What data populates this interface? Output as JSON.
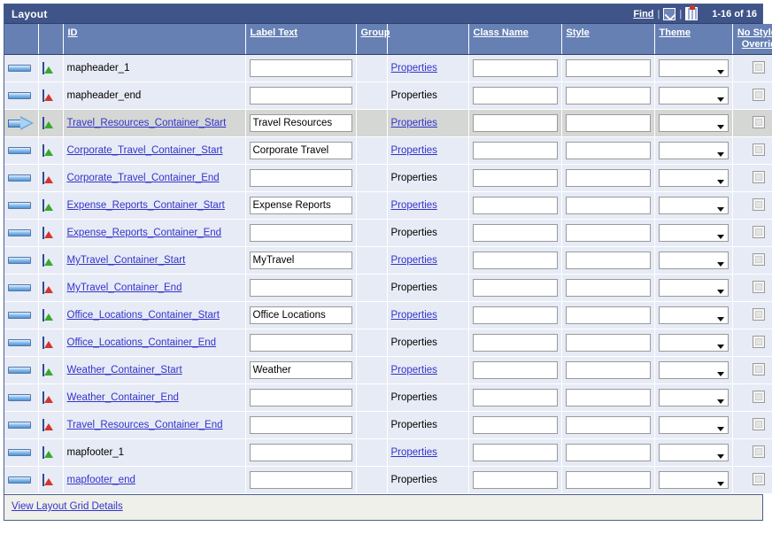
{
  "panel": {
    "title": "Layout",
    "nav": {
      "find_label": "Find",
      "separator": "|",
      "expand_icon": "expand-all-icon",
      "download_icon": "download-to-spreadsheet-icon",
      "row_count": "1-16 of 16"
    },
    "footer_link": "View Layout Grid Details"
  },
  "columns": [
    {
      "key": "select",
      "label": "",
      "link": false
    },
    {
      "key": "icon",
      "label": "",
      "link": false
    },
    {
      "key": "id",
      "label": "ID",
      "link": true
    },
    {
      "key": "label_text",
      "label": "Label Text",
      "link": true
    },
    {
      "key": "group",
      "label": "Group",
      "link": true
    },
    {
      "key": "properties",
      "label": "",
      "link": false
    },
    {
      "key": "class_name",
      "label": "Class Name",
      "link": true
    },
    {
      "key": "style",
      "label": "Style",
      "link": true
    },
    {
      "key": "theme",
      "label": "Theme",
      "link": true
    },
    {
      "key": "no_styles",
      "label": "No Styles Override",
      "link": true
    }
  ],
  "colors": {
    "title_bar": "#3f5488",
    "column_header": "#6680b4",
    "row_background": "#e7ebf5",
    "selected_row": "#d4d7d4",
    "link": "#3333cc",
    "footer_background": "#eff0e9",
    "start_marker": "#3aa82a",
    "end_marker": "#d8342b"
  },
  "rows": [
    {
      "selected": false,
      "marker": "dash",
      "icon": "header-page-icon",
      "icon_kind": "header",
      "badge": "green",
      "id": "mapheader_1",
      "id_is_link": false,
      "label_text": "",
      "properties_label": "Properties",
      "properties_is_link": true,
      "class_name": "",
      "style": "",
      "theme": "",
      "no_styles_override": false
    },
    {
      "selected": false,
      "marker": "dash",
      "icon": "header-page-icon",
      "icon_kind": "header",
      "badge": "red",
      "id": "mapheader_end",
      "id_is_link": false,
      "label_text": "",
      "properties_label": "Properties",
      "properties_is_link": false,
      "class_name": "",
      "style": "",
      "theme": "",
      "no_styles_override": false
    },
    {
      "selected": true,
      "marker": "arrow",
      "icon": "container-icon",
      "icon_kind": "container",
      "badge": "green",
      "id": "Travel_Resources_Container_Start",
      "id_is_link": true,
      "label_text": "Travel Resources",
      "properties_label": "Properties",
      "properties_is_link": true,
      "class_name": "",
      "style": "",
      "theme": "",
      "no_styles_override": false
    },
    {
      "selected": false,
      "marker": "dash",
      "icon": "container-icon",
      "icon_kind": "container",
      "badge": "green",
      "id": "Corporate_Travel_Container_Start",
      "id_is_link": true,
      "label_text": "Corporate Travel",
      "properties_label": "Properties",
      "properties_is_link": true,
      "class_name": "",
      "style": "",
      "theme": "",
      "no_styles_override": false
    },
    {
      "selected": false,
      "marker": "dash",
      "icon": "container-icon",
      "icon_kind": "container",
      "badge": "red",
      "id": "Corporate_Travel_Container_End",
      "id_is_link": true,
      "label_text": "",
      "properties_label": "Properties",
      "properties_is_link": false,
      "class_name": "",
      "style": "",
      "theme": "",
      "no_styles_override": false
    },
    {
      "selected": false,
      "marker": "dash",
      "icon": "container-icon",
      "icon_kind": "container",
      "badge": "green",
      "id": "Expense_Reports_Container_Start",
      "id_is_link": true,
      "label_text": "Expense Reports",
      "properties_label": "Properties",
      "properties_is_link": true,
      "class_name": "",
      "style": "",
      "theme": "",
      "no_styles_override": false
    },
    {
      "selected": false,
      "marker": "dash",
      "icon": "container-icon",
      "icon_kind": "container",
      "badge": "red",
      "id": "Expense_Reports_Container_End",
      "id_is_link": true,
      "label_text": "",
      "properties_label": "Properties",
      "properties_is_link": false,
      "class_name": "",
      "style": "",
      "theme": "",
      "no_styles_override": false
    },
    {
      "selected": false,
      "marker": "dash",
      "icon": "container-icon",
      "icon_kind": "container",
      "badge": "green",
      "id": "MyTravel_Container_Start",
      "id_is_link": true,
      "label_text": "MyTravel",
      "properties_label": "Properties",
      "properties_is_link": true,
      "class_name": "",
      "style": "",
      "theme": "",
      "no_styles_override": false
    },
    {
      "selected": false,
      "marker": "dash",
      "icon": "container-icon",
      "icon_kind": "container",
      "badge": "red",
      "id": "MyTravel_Container_End",
      "id_is_link": true,
      "label_text": "",
      "properties_label": "Properties",
      "properties_is_link": false,
      "class_name": "",
      "style": "",
      "theme": "",
      "no_styles_override": false
    },
    {
      "selected": false,
      "marker": "dash",
      "icon": "container-icon",
      "icon_kind": "container",
      "badge": "green",
      "id": "Office_Locations_Container_Start",
      "id_is_link": true,
      "label_text": "Office Locations",
      "properties_label": "Properties",
      "properties_is_link": true,
      "class_name": "",
      "style": "",
      "theme": "",
      "no_styles_override": false
    },
    {
      "selected": false,
      "marker": "dash",
      "icon": "container-icon",
      "icon_kind": "container",
      "badge": "red",
      "id": "Office_Locations_Container_End",
      "id_is_link": true,
      "label_text": "",
      "properties_label": "Properties",
      "properties_is_link": false,
      "class_name": "",
      "style": "",
      "theme": "",
      "no_styles_override": false
    },
    {
      "selected": false,
      "marker": "dash",
      "icon": "container-icon",
      "icon_kind": "container",
      "badge": "green",
      "id": "Weather_Container_Start",
      "id_is_link": true,
      "label_text": "Weather",
      "properties_label": "Properties",
      "properties_is_link": true,
      "class_name": "",
      "style": "",
      "theme": "",
      "no_styles_override": false
    },
    {
      "selected": false,
      "marker": "dash",
      "icon": "container-icon",
      "icon_kind": "container",
      "badge": "red",
      "id": "Weather_Container_End",
      "id_is_link": true,
      "label_text": "",
      "properties_label": "Properties",
      "properties_is_link": false,
      "class_name": "",
      "style": "",
      "theme": "",
      "no_styles_override": false
    },
    {
      "selected": false,
      "marker": "dash",
      "icon": "container-icon",
      "icon_kind": "container",
      "badge": "red",
      "id": "Travel_Resources_Container_End",
      "id_is_link": true,
      "label_text": "",
      "properties_label": "Properties",
      "properties_is_link": false,
      "class_name": "",
      "style": "",
      "theme": "",
      "no_styles_override": false
    },
    {
      "selected": false,
      "marker": "dash",
      "icon": "footer-page-icon",
      "icon_kind": "footer",
      "badge": "green",
      "id": "mapfooter_1",
      "id_is_link": false,
      "label_text": "",
      "properties_label": "Properties",
      "properties_is_link": true,
      "class_name": "",
      "style": "",
      "theme": "",
      "no_styles_override": false
    },
    {
      "selected": false,
      "marker": "dash",
      "icon": "footer-page-icon",
      "icon_kind": "footer",
      "badge": "red",
      "id": "mapfooter_end",
      "id_is_link": true,
      "label_text": "",
      "properties_label": "Properties",
      "properties_is_link": false,
      "class_name": "",
      "style": "",
      "theme": "",
      "no_styles_override": false
    }
  ]
}
